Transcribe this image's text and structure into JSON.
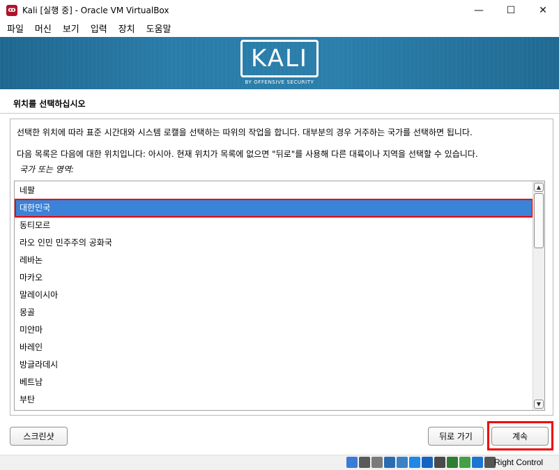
{
  "window": {
    "title": "Kali [실행 중] - Oracle VM VirtualBox",
    "app_icon_glyph": "ꝏ",
    "controls": {
      "minimize": "—",
      "maximize": "☐",
      "close": "✕"
    }
  },
  "menubar": {
    "items": [
      {
        "label": "파일"
      },
      {
        "label": "머신"
      },
      {
        "label": "보기"
      },
      {
        "label": "입력"
      },
      {
        "label": "장치"
      },
      {
        "label": "도움말"
      }
    ]
  },
  "banner": {
    "logo_text": "KALI",
    "logo_subtitle": "BY OFFENSIVE SECURITY"
  },
  "installer": {
    "step_title": "위치를 선택하십시오",
    "description_1": "선택한 위치에 따라 표준 시간대와 시스템 로캘을 선택하는 따위의 작업을 합니다. 대부분의 경우 거주하는 국가를 선택하면 됩니다.",
    "description_2": "다음 목록은 다음에 대한 위치입니다: 아시아. 현재 위치가 목록에 없으면 \"뒤로\"를 사용해 다른 대륙이나 지역을 선택할 수 있습니다.",
    "field_label": "국가 또는 영역:",
    "countries": [
      "네팔",
      "대한민국",
      "동티모르",
      "라오 인민 민주주의 공화국",
      "레바논",
      "마카오",
      "말레이시아",
      "몽골",
      "미얀마",
      "바레인",
      "방글라데시",
      "베트남",
      "부탄"
    ],
    "selected_index": 1
  },
  "buttons": {
    "screenshot": "스크린샷",
    "back": "뒤로 가기",
    "continue": "계속"
  },
  "statusbar": {
    "host_key": "Right Control",
    "icons": [
      "hard-disk-icon",
      "optical-drive-icon",
      "audio-icon",
      "network-icon",
      "usb-icon",
      "shared-folders-icon",
      "display-icon",
      "video-capture-icon",
      "cpu-icon",
      "guest-additions-icon",
      "mouse-integration-icon",
      "keyboard-icon"
    ],
    "icon_colors": [
      "#3a7bd5",
      "#5a5a5a",
      "#7a7a7a",
      "#2b6cb0",
      "#3b82c4",
      "#1e88e5",
      "#1565c0",
      "#4a4a4a",
      "#2e7d32",
      "#43a047",
      "#1976d2",
      "#555555"
    ]
  },
  "colors": {
    "selection": "#3a83d8",
    "highlight_outline": "#ee0000",
    "banner": "#2a7ca8"
  }
}
